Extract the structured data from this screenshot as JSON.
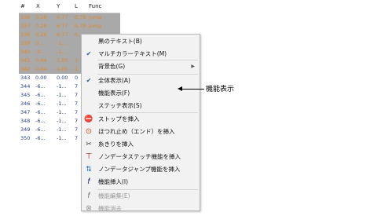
{
  "table": {
    "headers": [
      "#",
      "X",
      "Y",
      "L",
      "Func"
    ],
    "rows": [
      {
        "n": "336",
        "x": "0.28",
        "y": "6.77",
        "l": "6.78",
        "f": "jump",
        "style": "orange"
      },
      {
        "n": "337",
        "x": "0.28",
        "y": "6.77",
        "l": "6.78",
        "f": "jump",
        "style": "orange"
      },
      {
        "n": "338",
        "x": "0.28",
        "y": "6.77",
        "l": "6.",
        "f": "",
        "style": "orange"
      },
      {
        "n": "339",
        "x": "0...",
        "y": "-1...",
        "l": "",
        "f": "",
        "style": "orange"
      },
      {
        "n": "340",
        "x": "-0...",
        "y": "-1...",
        "l": "",
        "f": "",
        "style": "orange"
      },
      {
        "n": "341",
        "x": "0.04",
        "y": "1.00",
        "l": "1",
        "f": "",
        "style": "orange"
      },
      {
        "n": "342",
        "x": "0.04",
        "y": "1.00",
        "l": "1",
        "f": "",
        "style": "orange"
      },
      {
        "n": "343",
        "x": "0.00",
        "y": "0.00",
        "l": "0",
        "f": "",
        "style": "blue"
      },
      {
        "n": "344",
        "x": "-6...",
        "y": "-1...",
        "l": "7",
        "f": "",
        "style": "blue"
      },
      {
        "n": "345",
        "x": "-6...",
        "y": "-1...",
        "l": "7",
        "f": "",
        "style": "blue"
      },
      {
        "n": "346",
        "x": "-6...",
        "y": "-1...",
        "l": "7",
        "f": "",
        "style": "blue"
      },
      {
        "n": "347",
        "x": "-6...",
        "y": "-1...",
        "l": "7",
        "f": "",
        "style": "blue"
      },
      {
        "n": "348",
        "x": "-6...",
        "y": "-1...",
        "l": "7",
        "f": "",
        "style": "blue"
      },
      {
        "n": "349",
        "x": "-6...",
        "y": "-1...",
        "l": "7",
        "f": "",
        "style": "blue"
      },
      {
        "n": "350",
        "x": "-6...",
        "y": "-1...",
        "l": "7",
        "f": "",
        "style": "blue"
      }
    ]
  },
  "menu": {
    "items": [
      {
        "label": "黒のテキスト(B)",
        "icon": "",
        "enabled": true
      },
      {
        "label": "マルチカラーテキスト(M)",
        "icon": "check-icon",
        "enabled": true
      },
      {
        "label": "背景色(G)",
        "icon": "",
        "enabled": true,
        "submenu": true
      },
      {
        "label": "全体表示(A)",
        "icon": "check-icon",
        "enabled": true
      },
      {
        "label": "機能表示(F)",
        "icon": "",
        "enabled": true
      },
      {
        "label": "ステッチ表示(S)",
        "icon": "",
        "enabled": true
      },
      {
        "label": "ストップを挿入",
        "icon": "stop-icon",
        "enabled": true
      },
      {
        "label": "ほつれ止め（エンド）を挿入",
        "icon": "tie-off-icon",
        "enabled": true
      },
      {
        "label": "糸きりを挿入",
        "icon": "trim-icon",
        "enabled": true
      },
      {
        "label": "ノンデータステッチ機能を挿入",
        "icon": "non-data-stitch-icon",
        "enabled": true
      },
      {
        "label": "ノンデータジャンプ機能を挿入",
        "icon": "non-data-jump-icon",
        "enabled": true
      },
      {
        "label": "機能挿入(I)",
        "icon": "function-insert-icon",
        "enabled": true
      },
      {
        "label": "機能編集(E)",
        "icon": "function-edit-icon",
        "enabled": false
      },
      {
        "label": "機能消去",
        "icon": "function-delete-icon",
        "enabled": false
      }
    ]
  },
  "callout": {
    "text": "機能表示"
  }
}
